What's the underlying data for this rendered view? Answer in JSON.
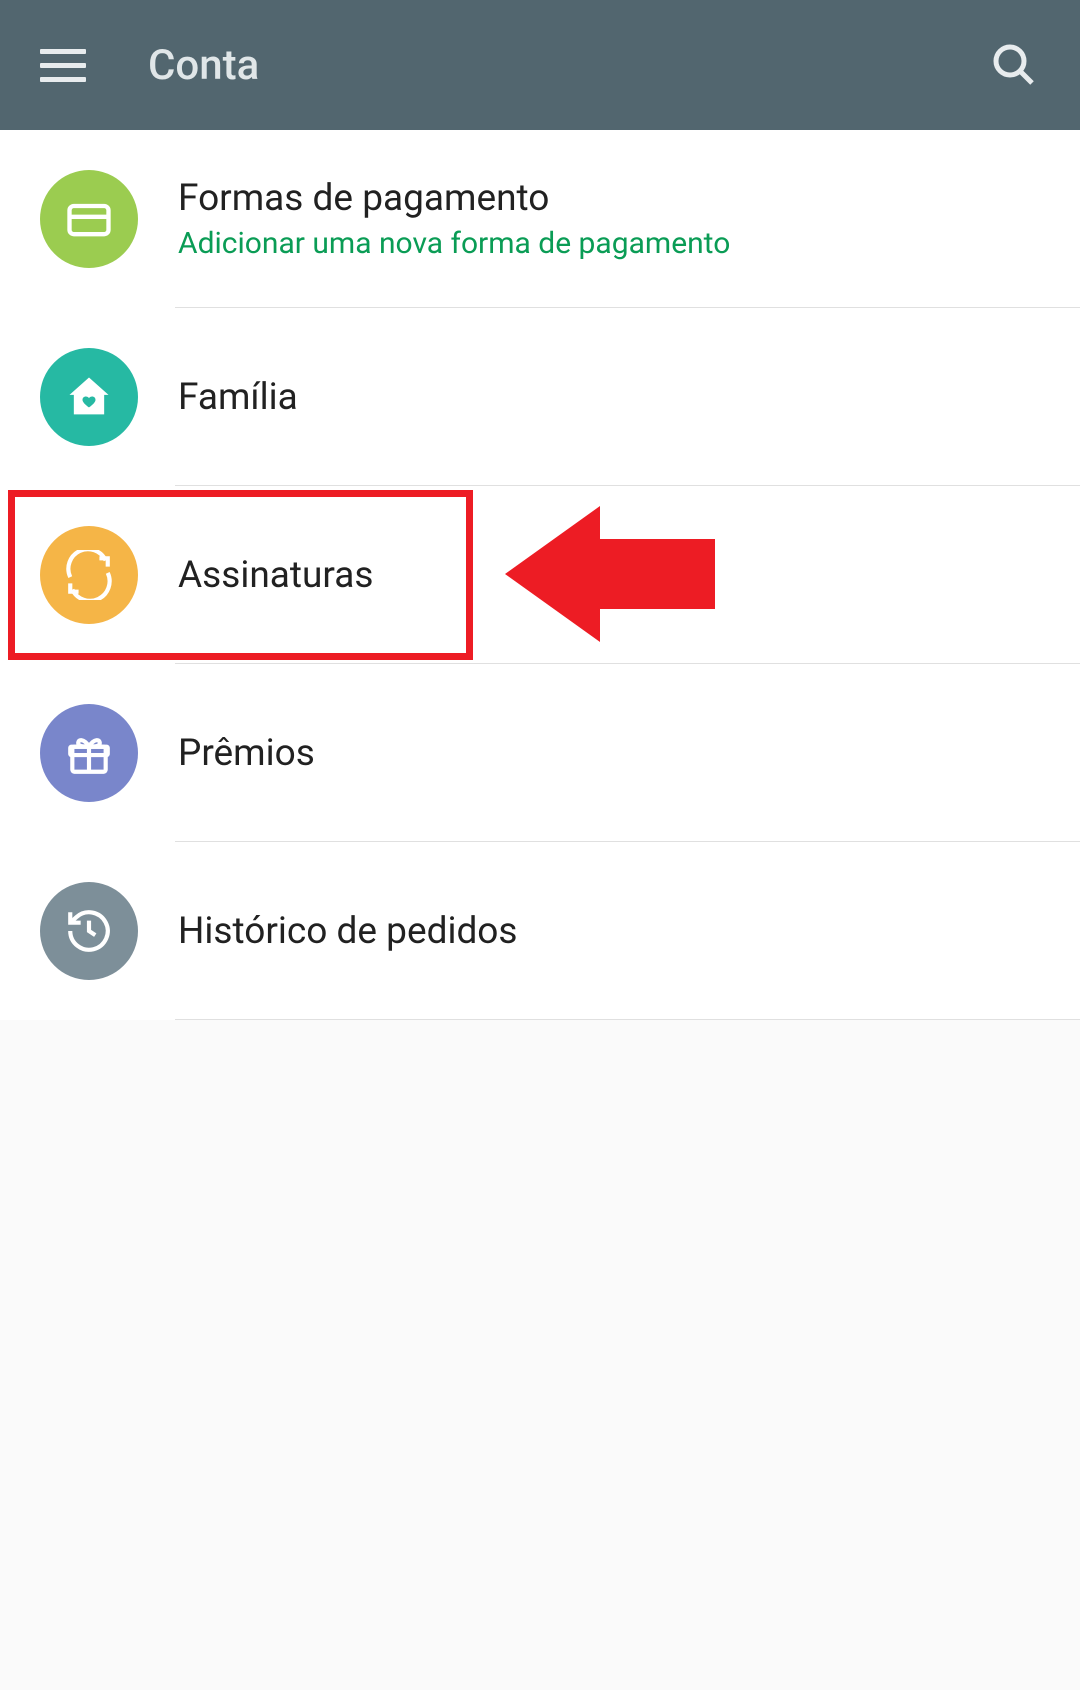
{
  "header": {
    "title": "Conta"
  },
  "items": [
    {
      "title": "Formas de pagamento",
      "subtitle": "Adicionar uma nova forma de pagamento",
      "icon": "card-icon",
      "color": "green"
    },
    {
      "title": "Família",
      "subtitle": "",
      "icon": "home-heart-icon",
      "color": "teal"
    },
    {
      "title": "Assinaturas",
      "subtitle": "",
      "icon": "sync-icon",
      "color": "orange"
    },
    {
      "title": "Prêmios",
      "subtitle": "",
      "icon": "gift-icon",
      "color": "purple"
    },
    {
      "title": "Histórico de pedidos",
      "subtitle": "",
      "icon": "history-icon",
      "color": "gray"
    }
  ],
  "annotation": {
    "highlight_index": 2
  }
}
